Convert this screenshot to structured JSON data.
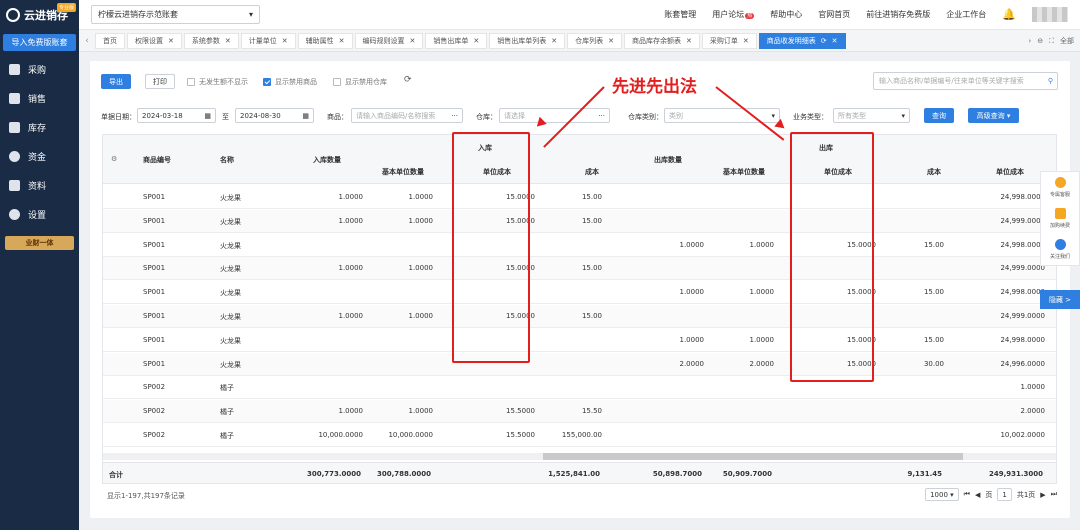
{
  "app": {
    "name": "云进销存",
    "badge": "专业版"
  },
  "sidebar": {
    "import_label": "导入免费版账套",
    "items": [
      {
        "label": "采购",
        "icon": "cart-icon"
      },
      {
        "label": "销售",
        "icon": "sales-icon"
      },
      {
        "label": "库存",
        "icon": "warehouse-icon"
      },
      {
        "label": "资金",
        "icon": "money-icon"
      },
      {
        "label": "资料",
        "icon": "document-icon"
      },
      {
        "label": "设置",
        "icon": "gear-icon"
      }
    ],
    "promo": "业财一体"
  },
  "topbar": {
    "account": "柠檬云进销存示范账套",
    "links": [
      "账套管理",
      "用户论坛",
      "帮助中心",
      "官网首页",
      "前往进销存免费版",
      "企业工作台"
    ],
    "hot": "热"
  },
  "tabs": {
    "items": [
      "首页",
      "权限设置",
      "系统参数",
      "计量单位",
      "辅助属性",
      "编码规则设置",
      "销售出库单",
      "销售出库单列表",
      "仓库列表",
      "商品库存余额表",
      "采购订单",
      "商品收发明细表"
    ],
    "right": [
      "全部"
    ]
  },
  "toolbar": {
    "export": "导出",
    "print": "打印",
    "check_no_show": "无发生额不显示",
    "check_disabled_goods": "显示禁用商品",
    "check_disabled_wh": "显示禁用仓库",
    "search_placeholder": "输入商品名称/单据编号/往来单位等关键字搜索"
  },
  "filters": {
    "date_label": "单据日期：",
    "date_from": "2024-03-18",
    "to": "至",
    "date_to": "2024-08-30",
    "goods_label": "商品：",
    "goods_placeholder": "请输入商品编码/名称搜索",
    "wh_label": "仓库：",
    "wh_placeholder": "请选择",
    "whcat_label": "仓库类别：",
    "whcat_placeholder": "类别",
    "biz_label": "业务类型：",
    "biz_placeholder": "所有类型",
    "query": "查询",
    "advanced": "高级查询"
  },
  "table": {
    "headers": {
      "code": "商品编号",
      "name": "名称",
      "in_group": "入库",
      "in_qty": "入库数量",
      "in_base_qty": "基本单位数量",
      "in_unit_cost": "单位成本",
      "in_cost": "成本",
      "out_group": "出库",
      "out_qty": "出库数量",
      "out_base_qty": "基本单位数量",
      "out_unit_cost": "单位成本",
      "out_cost": "成本",
      "bal_unit_cost": "单位成本"
    },
    "rows": [
      {
        "code": "SP001",
        "name": "火龙果",
        "in_qty": "1.0000",
        "in_base": "1.0000",
        "in_uc": "15.0000",
        "in_cost": "15.00",
        "out_qty": "",
        "out_base": "",
        "out_uc": "",
        "out_cost": "",
        "bal": "24,998.0000"
      },
      {
        "code": "SP001",
        "name": "火龙果",
        "in_qty": "1.0000",
        "in_base": "1.0000",
        "in_uc": "15.0000",
        "in_cost": "15.00",
        "out_qty": "",
        "out_base": "",
        "out_uc": "",
        "out_cost": "",
        "bal": "24,999.0000"
      },
      {
        "code": "SP001",
        "name": "火龙果",
        "in_qty": "",
        "in_base": "",
        "in_uc": "",
        "in_cost": "",
        "out_qty": "1.0000",
        "out_base": "1.0000",
        "out_uc": "15.0000",
        "out_cost": "15.00",
        "bal": "24,998.0000"
      },
      {
        "code": "SP001",
        "name": "火龙果",
        "in_qty": "1.0000",
        "in_base": "1.0000",
        "in_uc": "15.0000",
        "in_cost": "15.00",
        "out_qty": "",
        "out_base": "",
        "out_uc": "",
        "out_cost": "",
        "bal": "24,999.0000"
      },
      {
        "code": "SP001",
        "name": "火龙果",
        "in_qty": "",
        "in_base": "",
        "in_uc": "",
        "in_cost": "",
        "out_qty": "1.0000",
        "out_base": "1.0000",
        "out_uc": "15.0000",
        "out_cost": "15.00",
        "bal": "24,998.0000"
      },
      {
        "code": "SP001",
        "name": "火龙果",
        "in_qty": "1.0000",
        "in_base": "1.0000",
        "in_uc": "15.0000",
        "in_cost": "15.00",
        "out_qty": "",
        "out_base": "",
        "out_uc": "",
        "out_cost": "",
        "bal": "24,999.0000"
      },
      {
        "code": "SP001",
        "name": "火龙果",
        "in_qty": "",
        "in_base": "",
        "in_uc": "",
        "in_cost": "",
        "out_qty": "1.0000",
        "out_base": "1.0000",
        "out_uc": "15.0000",
        "out_cost": "15.00",
        "bal": "24,998.0000"
      },
      {
        "code": "SP001",
        "name": "火龙果",
        "in_qty": "",
        "in_base": "",
        "in_uc": "",
        "in_cost": "",
        "out_qty": "2.0000",
        "out_base": "2.0000",
        "out_uc": "15.0000",
        "out_cost": "30.00",
        "bal": "24,996.0000"
      },
      {
        "code": "SP002",
        "name": "橘子",
        "in_qty": "",
        "in_base": "",
        "in_uc": "",
        "in_cost": "",
        "out_qty": "",
        "out_base": "",
        "out_uc": "",
        "out_cost": "",
        "bal": "1.0000"
      },
      {
        "code": "SP002",
        "name": "橘子",
        "in_qty": "1.0000",
        "in_base": "1.0000",
        "in_uc": "15.5000",
        "in_cost": "15.50",
        "out_qty": "",
        "out_base": "",
        "out_uc": "",
        "out_cost": "",
        "bal": "2.0000"
      },
      {
        "code": "SP002",
        "name": "橘子",
        "in_qty": "10,000.0000",
        "in_base": "10,000.0000",
        "in_uc": "15.5000",
        "in_cost": "155,000.00",
        "out_qty": "",
        "out_base": "",
        "out_uc": "",
        "out_cost": "",
        "bal": "10,002.0000"
      }
    ],
    "total": {
      "label": "合计",
      "in_qty": "300,773.0000",
      "in_base": "300,788.0000",
      "in_cost": "1,525,841.00",
      "out_qty": "50,898.7000",
      "out_base": "50,909.7000",
      "out_cost": "9,131.45",
      "bal": "249,931.3000"
    }
  },
  "footer": {
    "count": "显示1-197,共197条记录",
    "page_size": "1000",
    "page": "1",
    "page_text": "页",
    "total_pages": "共1页"
  },
  "annotation": "先进先出法",
  "widgets": {
    "service": "专属客服",
    "renew": "加购续费",
    "follow": "关注我们",
    "hide": "隐藏 >"
  },
  "colors": {
    "sidebar": "#1a2b45",
    "accent": "#2f7fe0",
    "highlight": "#e21e1e"
  }
}
